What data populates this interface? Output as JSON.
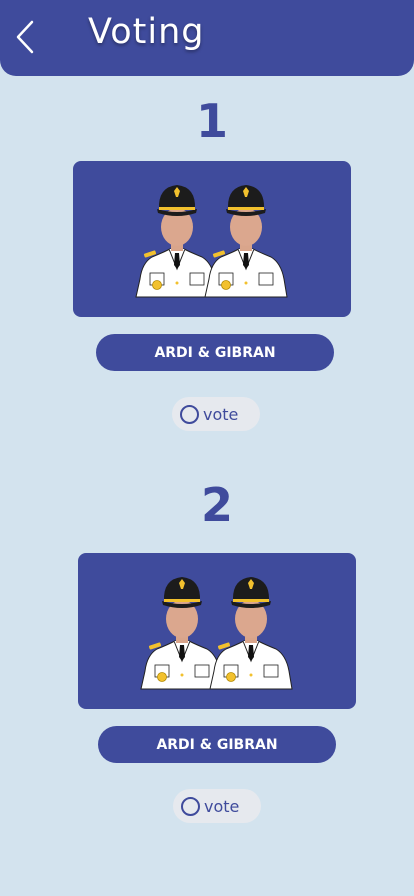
{
  "header": {
    "title": "Voting",
    "back_icon": "chevron-left-icon"
  },
  "colors": {
    "primary": "#3f4b9c",
    "background": "#d3e3ee",
    "vote_pill": "#e6e9ee"
  },
  "candidates": [
    {
      "number": "1",
      "name": "ARDI & GIBRAN",
      "vote_label": "vote",
      "selected": false
    },
    {
      "number": "2",
      "name": "ARDI & GIBRAN",
      "vote_label": "vote",
      "selected": false
    }
  ]
}
